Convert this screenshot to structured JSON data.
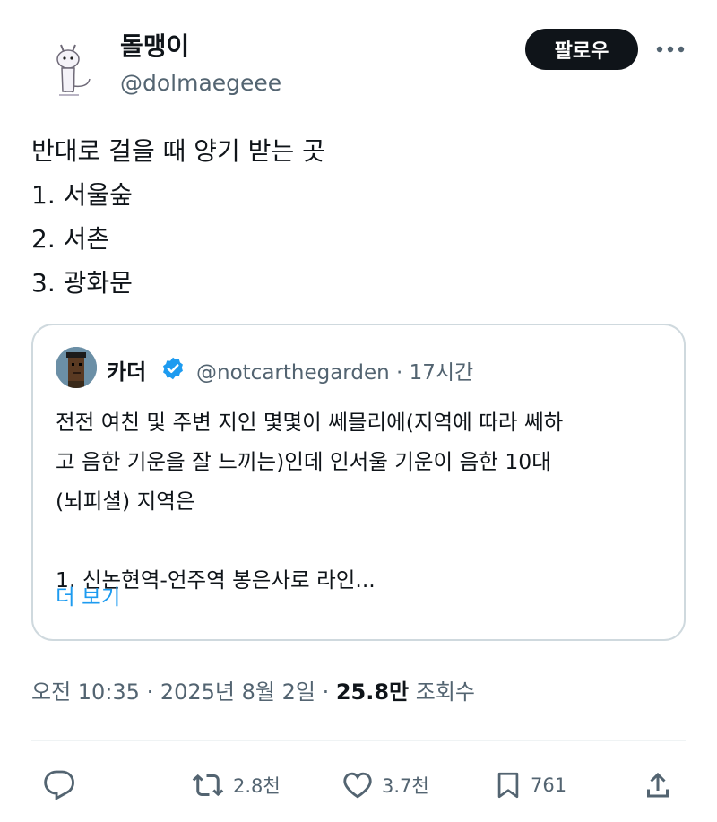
{
  "author": {
    "display_name": "돌맹이",
    "handle": "@dolmaegeee",
    "follow_label": "팔로우"
  },
  "tweet": {
    "lines": [
      "반대로 걸을 때 양기 받는 곳",
      "1. 서울숲",
      "2. 서촌",
      "3. 광화문"
    ]
  },
  "quote": {
    "name": "카더",
    "handle_time": "@notcarthegarden · 17시간",
    "lines": [
      "전전 여친 및 주변 지인 몇몇이 쎄믈리에(지역에 따라 쎄하",
      "고 음한 기운을 잘 느끼는)인데 인서울 기운이 음한 10대",
      "(뇌피셜) 지역은",
      "",
      "1. 신논현역-언주역 봉은사로 라인..."
    ],
    "more_label": "더 보기"
  },
  "meta": {
    "time_date": "오전 10:35 · 2025년 8월 2일 · ",
    "views_count": "25.8만",
    "views_label": " 조회수"
  },
  "actions": {
    "retweets": "2.8천",
    "likes": "3.7천",
    "bookmarks": "761"
  },
  "icons": {
    "reply": "reply-icon",
    "retweet": "retweet-icon",
    "like": "heart-icon",
    "bookmark": "bookmark-icon",
    "share": "share-icon",
    "more": "more-dots-icon",
    "verified": "verified-badge-icon"
  },
  "colors": {
    "accent": "#1d9bf0",
    "text": "#0f1419",
    "secondary": "#536471",
    "border": "#cfd9de"
  }
}
